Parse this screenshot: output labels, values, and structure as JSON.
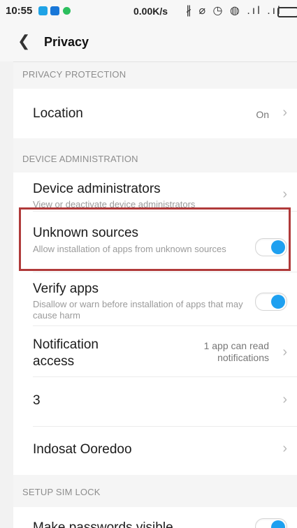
{
  "status_bar": {
    "time": "10:55",
    "speed": "0.00K/s",
    "icons_text": "∦ ⌀ ◷ ◍ .ıl .ıl"
  },
  "header": {
    "title": "Privacy"
  },
  "sections": {
    "privacy_protection": "PRIVACY PROTECTION",
    "device_administration": "DEVICE ADMINISTRATION",
    "setup_sim_lock": "SETUP SIM LOCK"
  },
  "rows": {
    "location": {
      "title": "Location",
      "value": "On"
    },
    "device_admins": {
      "title": "Device administrators",
      "subtitle": "View or deactivate device administrators"
    },
    "unknown_sources": {
      "title": "Unknown sources",
      "subtitle": "Allow installation of apps from unknown sources",
      "enabled": true
    },
    "verify_apps": {
      "title": "Verify apps",
      "subtitle": "Disallow or warn before installation of apps that may cause harm",
      "enabled": true
    },
    "notification_access": {
      "title_line1": "Notification",
      "title_line2": "access",
      "value_line1": "1 app can read",
      "value_line2": "notifications"
    },
    "sim3": {
      "title": "3"
    },
    "indosat": {
      "title": "Indosat Ooredoo"
    },
    "make_passwords": {
      "title": "Make passwords visible",
      "enabled": true
    }
  },
  "colors": {
    "toggle_on": "#1ea0f0",
    "highlight_border": "#b03a3a"
  }
}
